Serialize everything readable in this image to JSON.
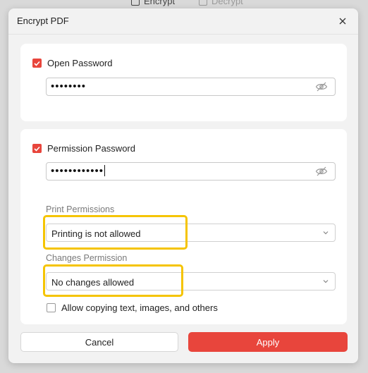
{
  "background_tabs": {
    "encrypt_label": "Encrypt",
    "decrypt_label": "Decrypt"
  },
  "dialog": {
    "title": "Encrypt PDF"
  },
  "open_password": {
    "checkbox_label": "Open Password",
    "checked": true,
    "value_masked": "••••••••"
  },
  "permission_password": {
    "checkbox_label": "Permission Password",
    "checked": true,
    "value_masked": "••••••••••••"
  },
  "print_permissions": {
    "label": "Print Permissions",
    "selected": "Printing is not allowed"
  },
  "changes_permission": {
    "label": "Changes Permission",
    "selected": "No changes allowed"
  },
  "allow_copying": {
    "label": "Allow copying text, images, and others",
    "checked": false
  },
  "buttons": {
    "cancel": "Cancel",
    "apply": "Apply"
  },
  "colors": {
    "accent": "#e8453c",
    "highlight": "#f5c400"
  },
  "icons": [
    "lock-icon",
    "unlock-icon",
    "close-icon",
    "eye-off-icon",
    "chevron-down-icon",
    "checkmark-icon"
  ]
}
